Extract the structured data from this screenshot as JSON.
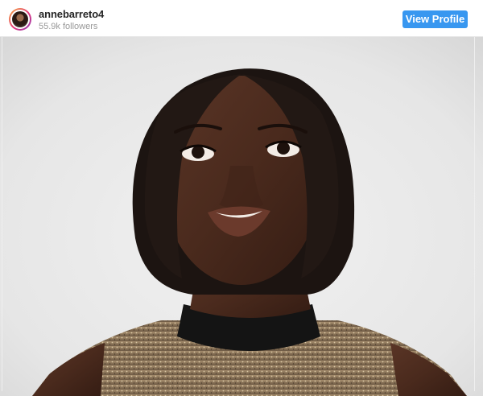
{
  "post": {
    "username": "annebarreto4",
    "followers": "55.9k followers",
    "view_profile_label": "View Profile"
  },
  "colors": {
    "button": "#3897f0",
    "username": "#262626",
    "followers": "#999999"
  },
  "icons": {
    "avatar": "profile-avatar"
  }
}
